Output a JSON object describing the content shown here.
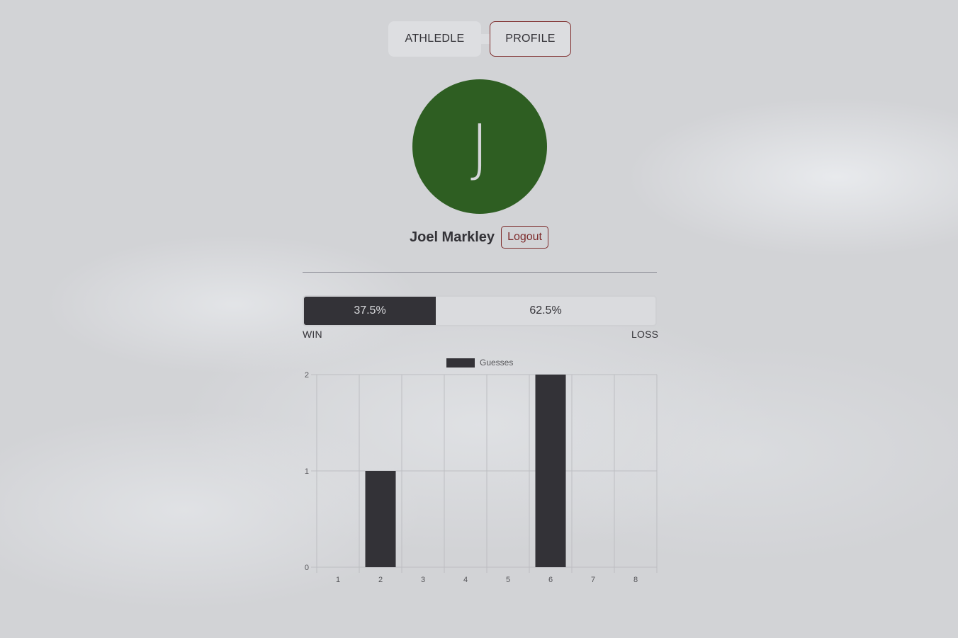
{
  "nav": {
    "items": [
      {
        "label": "ATHLEDLE"
      },
      {
        "label": "PROFILE"
      }
    ]
  },
  "profile": {
    "avatar_letter": "J",
    "avatar_color": "#2e5e22",
    "name": "Joel Markley",
    "logout_label": "Logout"
  },
  "stats": {
    "win_percent": 37.5,
    "win_text": "37.5%",
    "loss_text": "62.5%",
    "win_label": "WIN",
    "loss_label": "LOSS"
  },
  "colors": {
    "accent": "#7d2b2b",
    "bar": "#333237"
  },
  "chart_data": {
    "type": "bar",
    "title": "",
    "xlabel": "",
    "ylabel": "",
    "categories": [
      "1",
      "2",
      "3",
      "4",
      "5",
      "6",
      "7",
      "8"
    ],
    "series": [
      {
        "name": "Guesses",
        "values": [
          0,
          1,
          0,
          0,
          0,
          2,
          0,
          0
        ]
      }
    ],
    "ylim": [
      0,
      2
    ],
    "yticks": [
      "0",
      "1",
      "2"
    ],
    "grid": true,
    "legend": "top-center"
  }
}
